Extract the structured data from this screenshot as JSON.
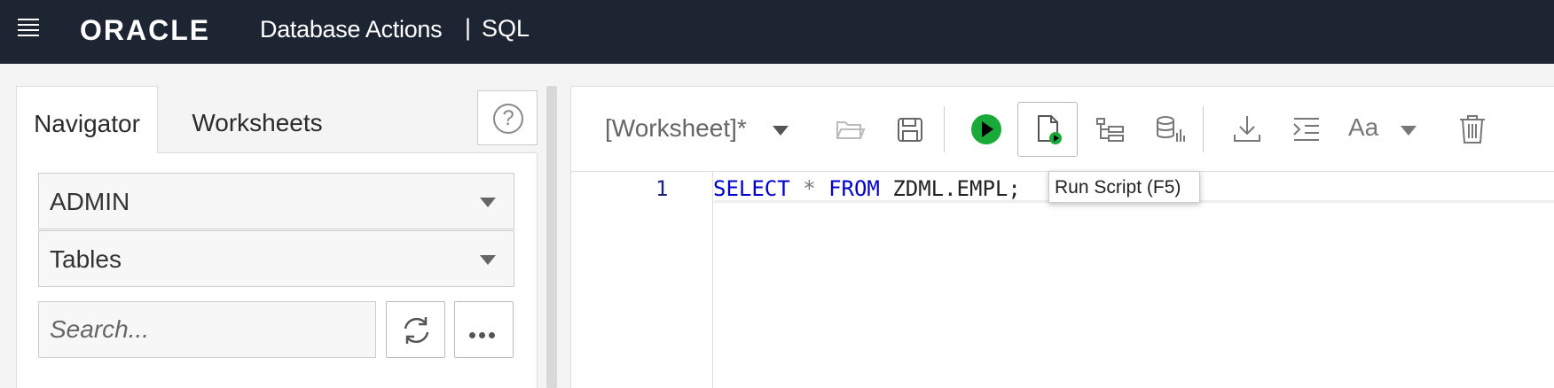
{
  "header": {
    "brand": "ORACLE",
    "app_title": "Database Actions",
    "separator": "|",
    "page": "SQL"
  },
  "left_panel": {
    "tabs": [
      {
        "label": "Navigator",
        "active": true
      },
      {
        "label": "Worksheets",
        "active": false
      }
    ],
    "help_label": "?",
    "schema_select": "ADMIN",
    "object_type_select": "Tables",
    "search_placeholder": "Search..."
  },
  "editor": {
    "worksheet_name": "[Worksheet]*",
    "toolbar_icons": [
      "folder-open-icon",
      "save-icon",
      "run-statement-icon",
      "run-script-icon",
      "explain-plan-icon",
      "autotrace-icon",
      "download-icon",
      "format-icon",
      "font-case-icon",
      "delete-icon"
    ],
    "lines": [
      {
        "number": "1",
        "tokens": {
          "kw1": "SELECT",
          "op": "*",
          "kw2": "FROM",
          "rest": "ZDML.EMPL;"
        }
      }
    ],
    "tooltip": "Run Script (F5)"
  },
  "colors": {
    "header_bg": "#1d2532",
    "run_green": "#1aaa3a",
    "keyword_blue": "#0000cd",
    "line_number": "#1a237e"
  }
}
